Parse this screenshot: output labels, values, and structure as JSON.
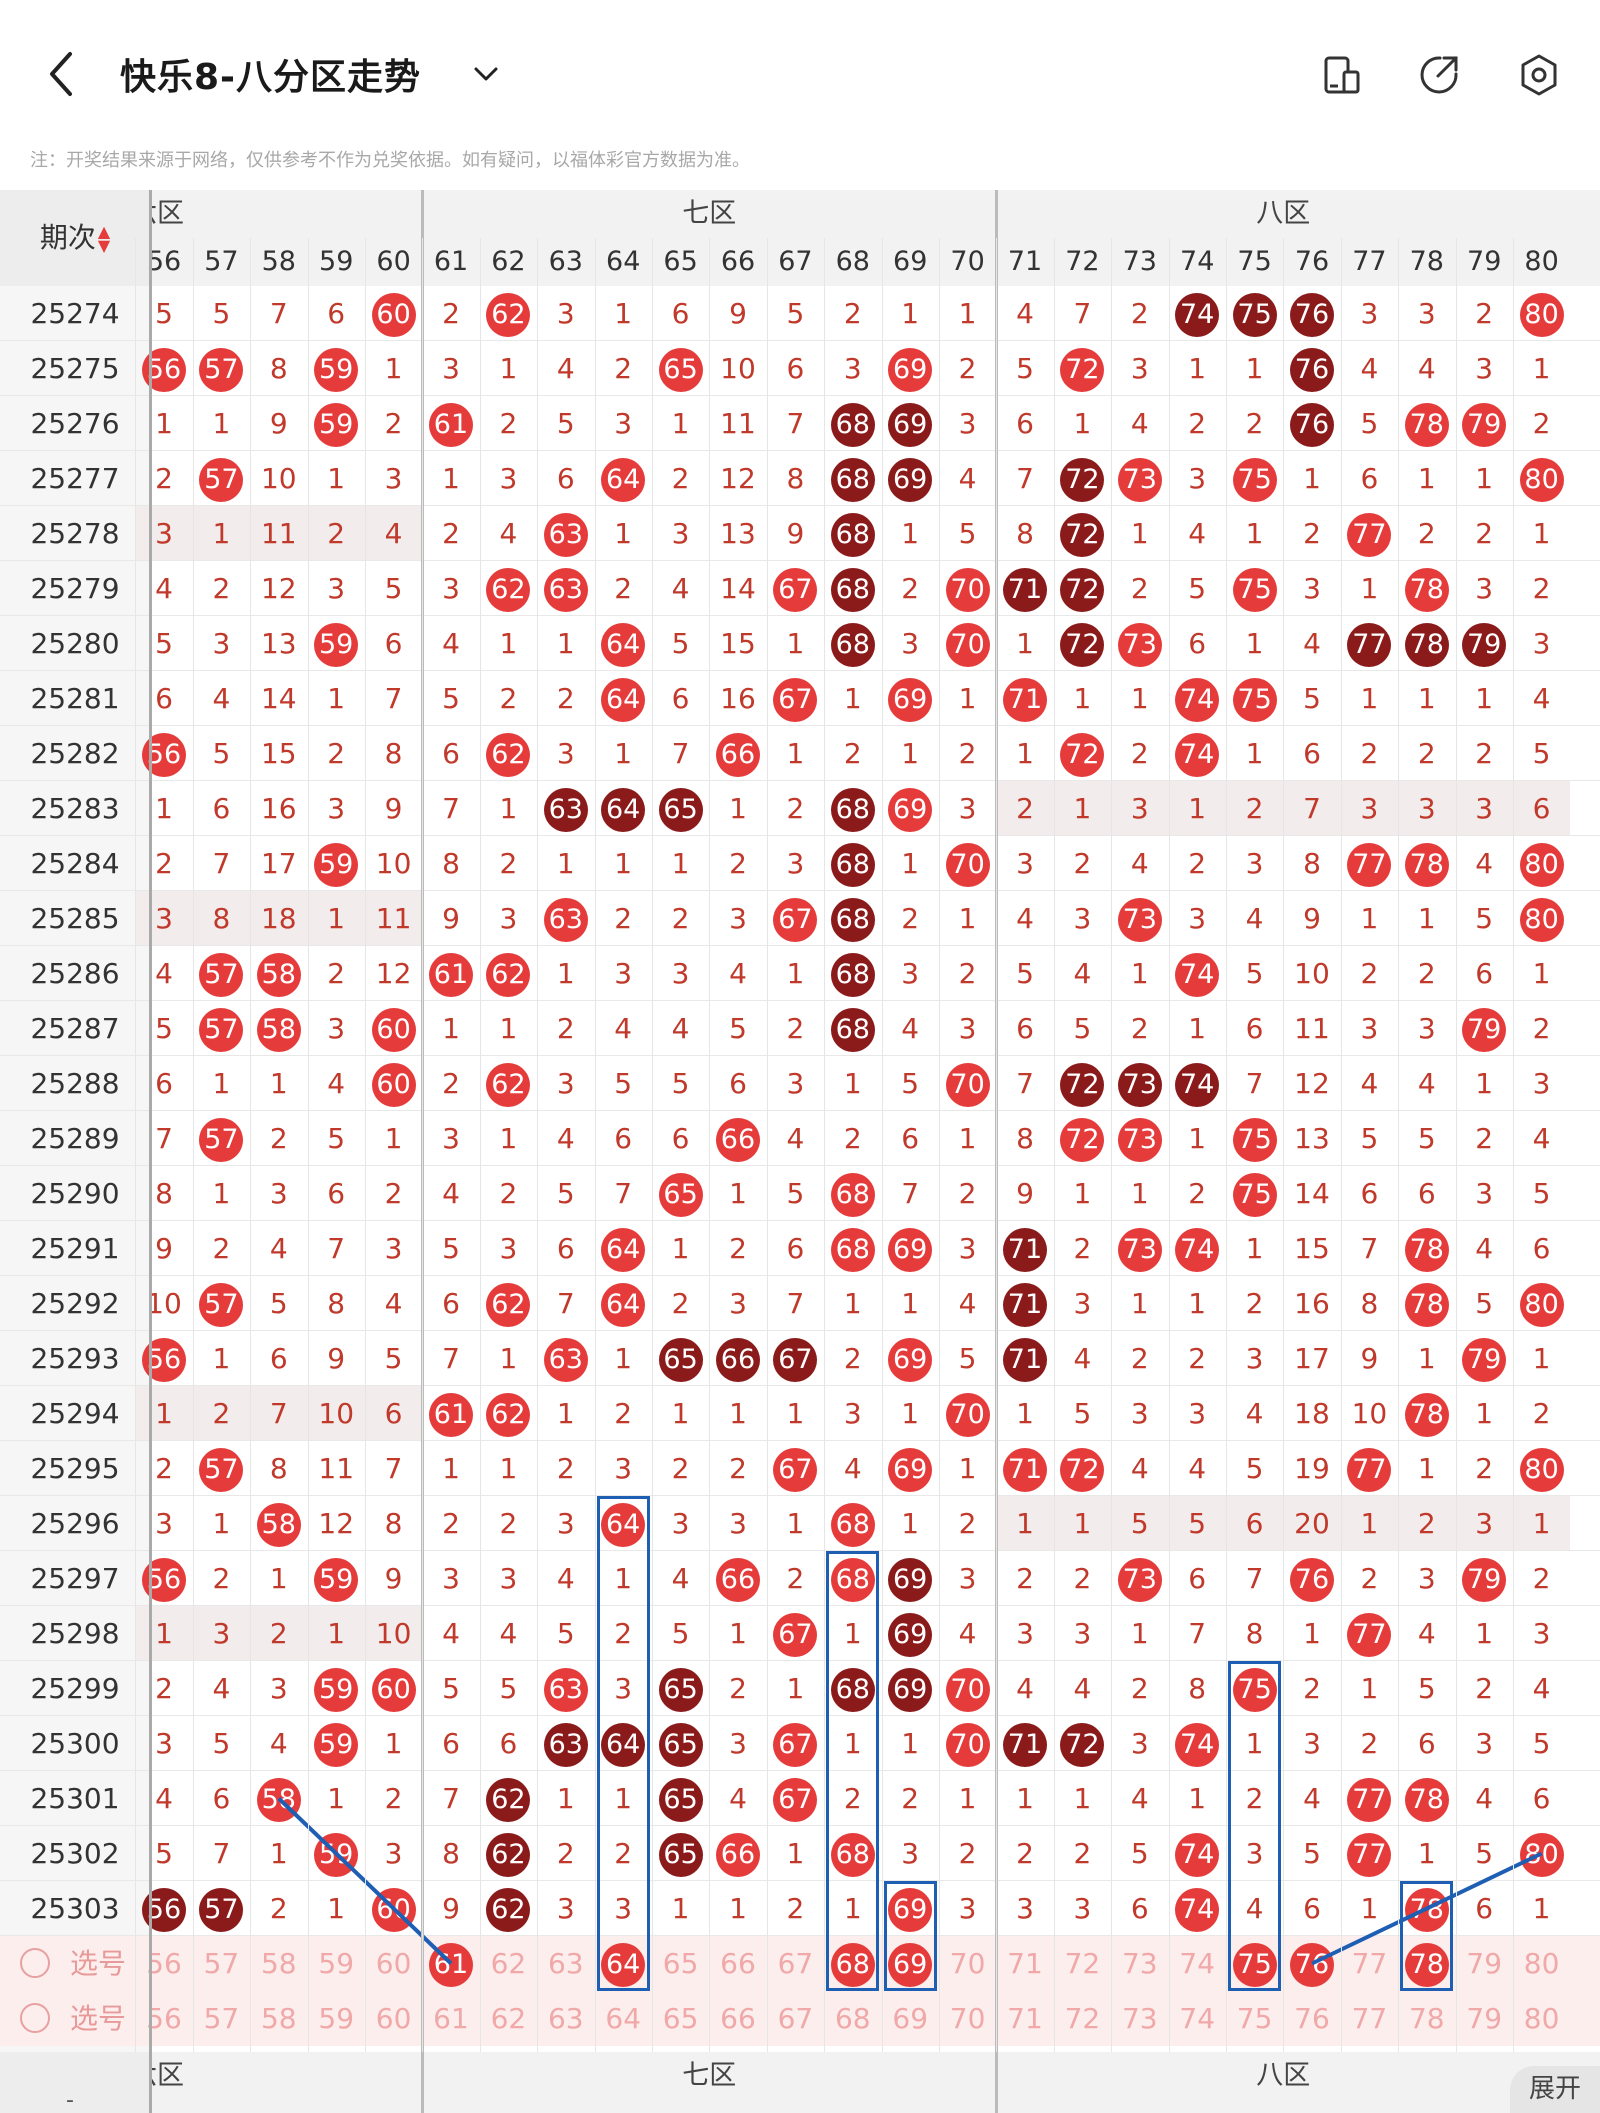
{
  "header": {
    "title": "快乐8-八分区走势",
    "icons": [
      "back-icon",
      "chevron-down-icon",
      "layout-icon",
      "share-icon",
      "settings-icon"
    ]
  },
  "notice": "注：开奖结果来源于网络，仅供参考不作为兑奖依据。如有疑问，以福体彩官方数据为准。",
  "table": {
    "issue_header": "期次",
    "zones": [
      {
        "label": "六区"
      },
      {
        "label": "七区"
      },
      {
        "label": "八区"
      }
    ],
    "numbers": [
      "56",
      "57",
      "58",
      "59",
      "60",
      "61",
      "62",
      "63",
      "64",
      "65",
      "66",
      "67",
      "68",
      "69",
      "70",
      "71",
      "72",
      "73",
      "74",
      "75",
      "76",
      "77",
      "78",
      "79",
      "80"
    ],
    "rows": [
      {
        "issue": "25274",
        "cells": [
          "5",
          "5",
          "7",
          "6",
          "60",
          "2",
          "62",
          "3",
          "1",
          "6",
          "9",
          "5",
          "2",
          "1",
          "1",
          "4",
          "7",
          "2",
          "74",
          "75",
          "76",
          "3",
          "3",
          "2",
          "80"
        ]
      },
      {
        "issue": "25275",
        "cells": [
          "56",
          "57",
          "8",
          "59",
          "1",
          "3",
          "1",
          "4",
          "2",
          "65",
          "10",
          "6",
          "3",
          "69",
          "2",
          "5",
          "72",
          "3",
          "1",
          "1",
          "76",
          "4",
          "4",
          "3",
          "1"
        ]
      },
      {
        "issue": "25276",
        "cells": [
          "1",
          "1",
          "9",
          "59",
          "2",
          "61",
          "2",
          "5",
          "3",
          "1",
          "11",
          "7",
          "68",
          "69",
          "3",
          "6",
          "1",
          "4",
          "2",
          "2",
          "76",
          "5",
          "78",
          "79",
          "2"
        ]
      },
      {
        "issue": "25277",
        "cells": [
          "2",
          "57",
          "10",
          "1",
          "3",
          "1",
          "3",
          "6",
          "64",
          "2",
          "12",
          "8",
          "68",
          "69",
          "4",
          "7",
          "72",
          "73",
          "3",
          "75",
          "1",
          "6",
          "1",
          "1",
          "80"
        ]
      },
      {
        "issue": "25278",
        "cells": [
          "3",
          "1",
          "11",
          "2",
          "4",
          "2",
          "4",
          "63",
          "1",
          "3",
          "13",
          "9",
          "68",
          "1",
          "5",
          "8",
          "72",
          "1",
          "4",
          "1",
          "2",
          "77",
          "2",
          "2",
          "1"
        ]
      },
      {
        "issue": "25279",
        "cells": [
          "4",
          "2",
          "12",
          "3",
          "5",
          "3",
          "62",
          "63",
          "2",
          "4",
          "14",
          "67",
          "68",
          "2",
          "70",
          "71",
          "72",
          "2",
          "5",
          "75",
          "3",
          "1",
          "78",
          "3",
          "2"
        ]
      },
      {
        "issue": "25280",
        "cells": [
          "5",
          "3",
          "13",
          "59",
          "6",
          "4",
          "1",
          "1",
          "64",
          "5",
          "15",
          "1",
          "68",
          "3",
          "70",
          "1",
          "72",
          "73",
          "6",
          "1",
          "4",
          "77",
          "78",
          "79",
          "3"
        ]
      },
      {
        "issue": "25281",
        "cells": [
          "6",
          "4",
          "14",
          "1",
          "7",
          "5",
          "2",
          "2",
          "64",
          "6",
          "16",
          "67",
          "1",
          "69",
          "1",
          "71",
          "1",
          "1",
          "74",
          "75",
          "5",
          "1",
          "1",
          "1",
          "4"
        ]
      },
      {
        "issue": "25282",
        "cells": [
          "56",
          "5",
          "15",
          "2",
          "8",
          "6",
          "62",
          "3",
          "1",
          "7",
          "66",
          "1",
          "2",
          "1",
          "2",
          "1",
          "72",
          "2",
          "74",
          "1",
          "6",
          "2",
          "2",
          "2",
          "5"
        ]
      },
      {
        "issue": "25283",
        "cells": [
          "1",
          "6",
          "16",
          "3",
          "9",
          "7",
          "1",
          "63",
          "64",
          "65",
          "1",
          "2",
          "68",
          "69",
          "3",
          "2",
          "1",
          "3",
          "1",
          "2",
          "7",
          "3",
          "3",
          "3",
          "6"
        ]
      },
      {
        "issue": "25284",
        "cells": [
          "2",
          "7",
          "17",
          "59",
          "10",
          "8",
          "2",
          "1",
          "1",
          "1",
          "2",
          "3",
          "68",
          "1",
          "70",
          "3",
          "2",
          "4",
          "2",
          "3",
          "8",
          "77",
          "78",
          "4",
          "80"
        ]
      },
      {
        "issue": "25285",
        "cells": [
          "3",
          "8",
          "18",
          "1",
          "11",
          "9",
          "3",
          "63",
          "2",
          "2",
          "3",
          "67",
          "68",
          "2",
          "1",
          "4",
          "3",
          "73",
          "3",
          "4",
          "9",
          "1",
          "1",
          "5",
          "80"
        ]
      },
      {
        "issue": "25286",
        "cells": [
          "4",
          "57",
          "58",
          "2",
          "12",
          "61",
          "62",
          "1",
          "3",
          "3",
          "4",
          "1",
          "68",
          "3",
          "2",
          "5",
          "4",
          "1",
          "74",
          "5",
          "10",
          "2",
          "2",
          "6",
          "1"
        ]
      },
      {
        "issue": "25287",
        "cells": [
          "5",
          "57",
          "58",
          "3",
          "60",
          "1",
          "1",
          "2",
          "4",
          "4",
          "5",
          "2",
          "68",
          "4",
          "3",
          "6",
          "5",
          "2",
          "1",
          "6",
          "11",
          "3",
          "3",
          "79",
          "2"
        ]
      },
      {
        "issue": "25288",
        "cells": [
          "6",
          "1",
          "1",
          "4",
          "60",
          "2",
          "62",
          "3",
          "5",
          "5",
          "6",
          "3",
          "1",
          "5",
          "70",
          "7",
          "72",
          "73",
          "74",
          "7",
          "12",
          "4",
          "4",
          "1",
          "3"
        ]
      },
      {
        "issue": "25289",
        "cells": [
          "7",
          "57",
          "2",
          "5",
          "1",
          "3",
          "1",
          "4",
          "6",
          "6",
          "66",
          "4",
          "2",
          "6",
          "1",
          "8",
          "72",
          "73",
          "1",
          "75",
          "13",
          "5",
          "5",
          "2",
          "4"
        ]
      },
      {
        "issue": "25290",
        "cells": [
          "8",
          "1",
          "3",
          "6",
          "2",
          "4",
          "2",
          "5",
          "7",
          "65",
          "1",
          "5",
          "68",
          "7",
          "2",
          "9",
          "1",
          "1",
          "2",
          "75",
          "14",
          "6",
          "6",
          "3",
          "5"
        ]
      },
      {
        "issue": "25291",
        "cells": [
          "9",
          "2",
          "4",
          "7",
          "3",
          "5",
          "3",
          "6",
          "64",
          "1",
          "2",
          "6",
          "68",
          "69",
          "3",
          "71",
          "2",
          "73",
          "74",
          "1",
          "15",
          "7",
          "78",
          "4",
          "6"
        ]
      },
      {
        "issue": "25292",
        "cells": [
          "10",
          "57",
          "5",
          "8",
          "4",
          "6",
          "62",
          "7",
          "64",
          "2",
          "3",
          "7",
          "1",
          "1",
          "4",
          "71",
          "3",
          "1",
          "1",
          "2",
          "16",
          "8",
          "78",
          "5",
          "80"
        ]
      },
      {
        "issue": "25293",
        "cells": [
          "56",
          "1",
          "6",
          "9",
          "5",
          "7",
          "1",
          "63",
          "1",
          "65",
          "66",
          "67",
          "2",
          "69",
          "5",
          "71",
          "4",
          "2",
          "2",
          "3",
          "17",
          "9",
          "1",
          "79",
          "1"
        ]
      },
      {
        "issue": "25294",
        "cells": [
          "1",
          "2",
          "7",
          "10",
          "6",
          "61",
          "62",
          "1",
          "2",
          "1",
          "1",
          "1",
          "3",
          "1",
          "70",
          "1",
          "5",
          "3",
          "3",
          "4",
          "18",
          "10",
          "78",
          "1",
          "2"
        ]
      },
      {
        "issue": "25295",
        "cells": [
          "2",
          "57",
          "8",
          "11",
          "7",
          "1",
          "1",
          "2",
          "3",
          "2",
          "2",
          "67",
          "4",
          "69",
          "1",
          "71",
          "72",
          "4",
          "4",
          "5",
          "19",
          "77",
          "1",
          "2",
          "80"
        ]
      },
      {
        "issue": "25296",
        "cells": [
          "3",
          "1",
          "58",
          "12",
          "8",
          "2",
          "2",
          "3",
          "64",
          "3",
          "3",
          "1",
          "68",
          "1",
          "2",
          "1",
          "1",
          "5",
          "5",
          "6",
          "20",
          "1",
          "2",
          "3",
          "1"
        ]
      },
      {
        "issue": "25297",
        "cells": [
          "56",
          "2",
          "1",
          "59",
          "9",
          "3",
          "3",
          "4",
          "1",
          "4",
          "66",
          "2",
          "68",
          "69",
          "3",
          "2",
          "2",
          "73",
          "6",
          "7",
          "76",
          "2",
          "3",
          "79",
          "2"
        ]
      },
      {
        "issue": "25298",
        "cells": [
          "1",
          "3",
          "2",
          "1",
          "10",
          "4",
          "4",
          "5",
          "2",
          "5",
          "1",
          "67",
          "1",
          "69",
          "4",
          "3",
          "3",
          "1",
          "7",
          "8",
          "1",
          "77",
          "4",
          "1",
          "3"
        ]
      },
      {
        "issue": "25299",
        "cells": [
          "2",
          "4",
          "3",
          "59",
          "60",
          "5",
          "5",
          "63",
          "3",
          "65",
          "2",
          "1",
          "68",
          "69",
          "70",
          "4",
          "4",
          "2",
          "8",
          "75",
          "2",
          "1",
          "5",
          "2",
          "4"
        ]
      },
      {
        "issue": "25300",
        "cells": [
          "3",
          "5",
          "4",
          "59",
          "1",
          "6",
          "6",
          "63",
          "64",
          "65",
          "3",
          "67",
          "1",
          "1",
          "70",
          "71",
          "72",
          "3",
          "74",
          "1",
          "3",
          "2",
          "6",
          "3",
          "5"
        ]
      },
      {
        "issue": "25301",
        "cells": [
          "4",
          "6",
          "58",
          "1",
          "2",
          "7",
          "62",
          "1",
          "1",
          "65",
          "4",
          "67",
          "2",
          "2",
          "1",
          "1",
          "1",
          "4",
          "1",
          "2",
          "4",
          "77",
          "78",
          "4",
          "6"
        ]
      },
      {
        "issue": "25302",
        "cells": [
          "5",
          "7",
          "1",
          "59",
          "3",
          "8",
          "62",
          "2",
          "2",
          "65",
          "66",
          "1",
          "68",
          "3",
          "2",
          "2",
          "2",
          "5",
          "74",
          "3",
          "5",
          "77",
          "1",
          "5",
          "80"
        ]
      },
      {
        "issue": "25303",
        "cells": [
          "56",
          "57",
          "2",
          "1",
          "60",
          "9",
          "62",
          "3",
          "3",
          "1",
          "1",
          "2",
          "1",
          "69",
          "3",
          "3",
          "3",
          "6",
          "74",
          "4",
          "6",
          "1",
          "78",
          "6",
          "1"
        ]
      }
    ],
    "select_rows": [
      {
        "label": "选号",
        "selected": [
          "61",
          "64",
          "68",
          "69",
          "75",
          "76",
          "78"
        ]
      },
      {
        "label": "选号",
        "selected": []
      }
    ],
    "expand_label": "展开"
  }
}
